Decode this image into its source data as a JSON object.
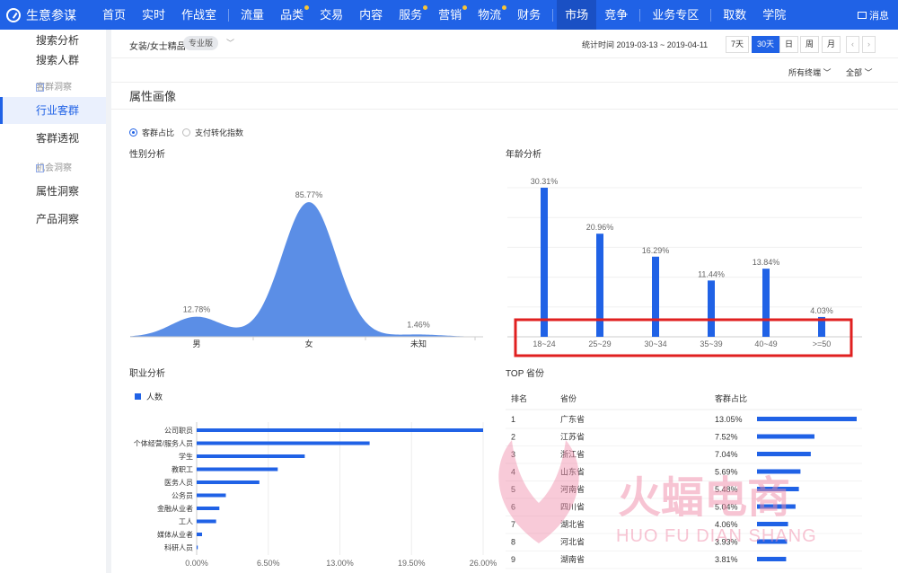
{
  "app": {
    "name": "生意参谋"
  },
  "nav": {
    "items": [
      {
        "label": "首页",
        "dot": false,
        "active": false
      },
      {
        "label": "实时",
        "dot": false,
        "active": false
      },
      {
        "label": "作战室",
        "dot": false,
        "active": false
      },
      {
        "label": "流量",
        "dot": false,
        "active": false
      },
      {
        "label": "品类",
        "dot": true,
        "active": false
      },
      {
        "label": "交易",
        "dot": false,
        "active": false
      },
      {
        "label": "内容",
        "dot": false,
        "active": false
      },
      {
        "label": "服务",
        "dot": true,
        "active": false
      },
      {
        "label": "营销",
        "dot": true,
        "active": false
      },
      {
        "label": "物流",
        "dot": true,
        "active": false
      },
      {
        "label": "财务",
        "dot": false,
        "active": false
      },
      {
        "label": "市场",
        "dot": false,
        "active": true
      },
      {
        "label": "竞争",
        "dot": false,
        "active": false
      },
      {
        "label": "业务专区",
        "dot": false,
        "active": false
      },
      {
        "label": "取数",
        "dot": false,
        "active": false
      },
      {
        "label": "学院",
        "dot": false,
        "active": false
      }
    ],
    "message_label": "消息"
  },
  "sidebar": {
    "items": [
      {
        "label": "搜索分析",
        "type": "item"
      },
      {
        "label": "搜索人群",
        "type": "item"
      },
      {
        "label": "客群洞察",
        "type": "group"
      },
      {
        "label": "行业客群",
        "type": "item",
        "active": true
      },
      {
        "label": "客群透视",
        "type": "item"
      },
      {
        "label": "机会洞察",
        "type": "group"
      },
      {
        "label": "属性洞察",
        "type": "item"
      },
      {
        "label": "产品洞察",
        "type": "item"
      }
    ]
  },
  "filter": {
    "category": "女装/女士精品",
    "badge": "专业版",
    "stat_time": "统计时间 2019-03-13 ~ 2019-04-11",
    "ranges": [
      "7天",
      "30天",
      "日",
      "周",
      "月"
    ],
    "active_range": "30天",
    "prev": "‹",
    "next": "›",
    "terminal": "所有终端",
    "scope": "全部"
  },
  "section": {
    "title": "属性画像"
  },
  "metric_options": [
    {
      "label": "客群占比",
      "selected": true
    },
    {
      "label": "支付转化指数",
      "selected": false
    }
  ],
  "gender": {
    "title": "性别分析",
    "chart_data": {
      "type": "area",
      "categories": [
        "男",
        "女",
        "未知"
      ],
      "values": [
        12.78,
        85.77,
        1.46
      ],
      "labels": [
        "12.78%",
        "85.77%",
        "1.46%"
      ]
    }
  },
  "age": {
    "title": "年龄分析",
    "chart_data": {
      "type": "bar",
      "categories": [
        "18~24",
        "25~29",
        "30~34",
        "35~39",
        "40~49",
        ">=50"
      ],
      "values": [
        30.31,
        20.96,
        16.29,
        11.44,
        13.84,
        4.03
      ],
      "labels": [
        "30.31%",
        "20.96%",
        "16.29%",
        "11.44%",
        "13.84%",
        "4.03%"
      ]
    }
  },
  "occupation": {
    "title": "职业分析",
    "legend": "人数",
    "chart_data": {
      "type": "bar",
      "orientation": "horizontal",
      "categories": [
        "公司职员",
        "个体经营/服务人员",
        "学生",
        "教职工",
        "医务人员",
        "公务员",
        "金融从业者",
        "工人",
        "媒体从业者",
        "科研人员"
      ],
      "values": [
        26.5,
        16.0,
        10.0,
        7.5,
        5.8,
        2.7,
        2.1,
        1.8,
        0.5,
        0.1
      ],
      "xticks": [
        "0.00%",
        "6.50%",
        "13.00%",
        "19.50%",
        "26.00%"
      ],
      "xlim": [
        0,
        26.5
      ]
    }
  },
  "top_province": {
    "title": "TOP 省份",
    "headers": [
      "排名",
      "省份",
      "客群占比"
    ],
    "rows": [
      {
        "rank": "1",
        "province": "广东省",
        "share": "13.05%",
        "value": 13.05
      },
      {
        "rank": "2",
        "province": "江苏省",
        "share": "7.52%",
        "value": 7.52
      },
      {
        "rank": "3",
        "province": "浙江省",
        "share": "7.04%",
        "value": 7.04
      },
      {
        "rank": "4",
        "province": "山东省",
        "share": "5.69%",
        "value": 5.69
      },
      {
        "rank": "5",
        "province": "河南省",
        "share": "5.48%",
        "value": 5.48
      },
      {
        "rank": "6",
        "province": "四川省",
        "share": "5.04%",
        "value": 5.04
      },
      {
        "rank": "7",
        "province": "湖北省",
        "share": "4.06%",
        "value": 4.06
      },
      {
        "rank": "8",
        "province": "河北省",
        "share": "3.93%",
        "value": 3.93
      },
      {
        "rank": "9",
        "province": "湖南省",
        "share": "3.81%",
        "value": 3.81
      }
    ]
  },
  "watermark": {
    "cn": "火蝠电商",
    "en": "HUO FU DIAN SHANG"
  },
  "colors": {
    "brand": "#2062e6",
    "bar": "#2062e6",
    "area": "#5b8ee6",
    "highlight": "#e02020"
  }
}
